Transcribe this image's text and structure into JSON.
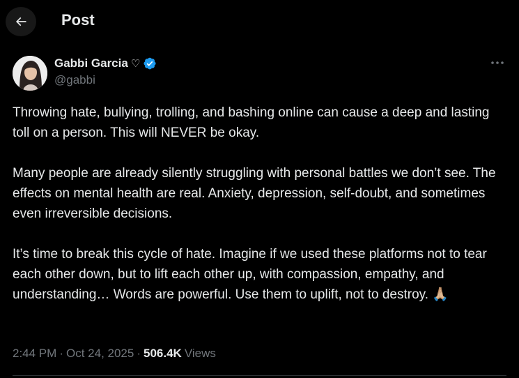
{
  "header": {
    "title": "Post"
  },
  "author": {
    "display_name": "Gabbi Garcia",
    "name_suffix": "♡",
    "handle": "@gabbi",
    "verified": true,
    "verified_color": "#1d9bf0",
    "avatar_icon": "avatar-photo"
  },
  "tweet": {
    "paragraphs": [
      "Throwing hate, bullying, trolling, and bashing online can cause a deep and lasting toll on a person. This will NEVER be okay.",
      "Many people are already silently struggling with personal battles we don’t see. The effects on mental health are real. Anxiety, depression, self-doubt, and sometimes even irreversible decisions.",
      "It’s time to break this cycle of hate. Imagine if we used these platforms not to tear each other down, but to lift each other up, with compassion, empathy, and understanding… Words are powerful. Use them to uplift, not to destroy. 🙏🏼"
    ]
  },
  "meta": {
    "time": "2:44 PM",
    "date": "Oct 24, 2025",
    "separator": "·",
    "views_count": "506.4K",
    "views_label": "Views"
  },
  "colors": {
    "background": "#000000",
    "text": "#e7e9ea",
    "muted": "#71767b",
    "border": "#2f3336",
    "accent": "#1d9bf0"
  }
}
